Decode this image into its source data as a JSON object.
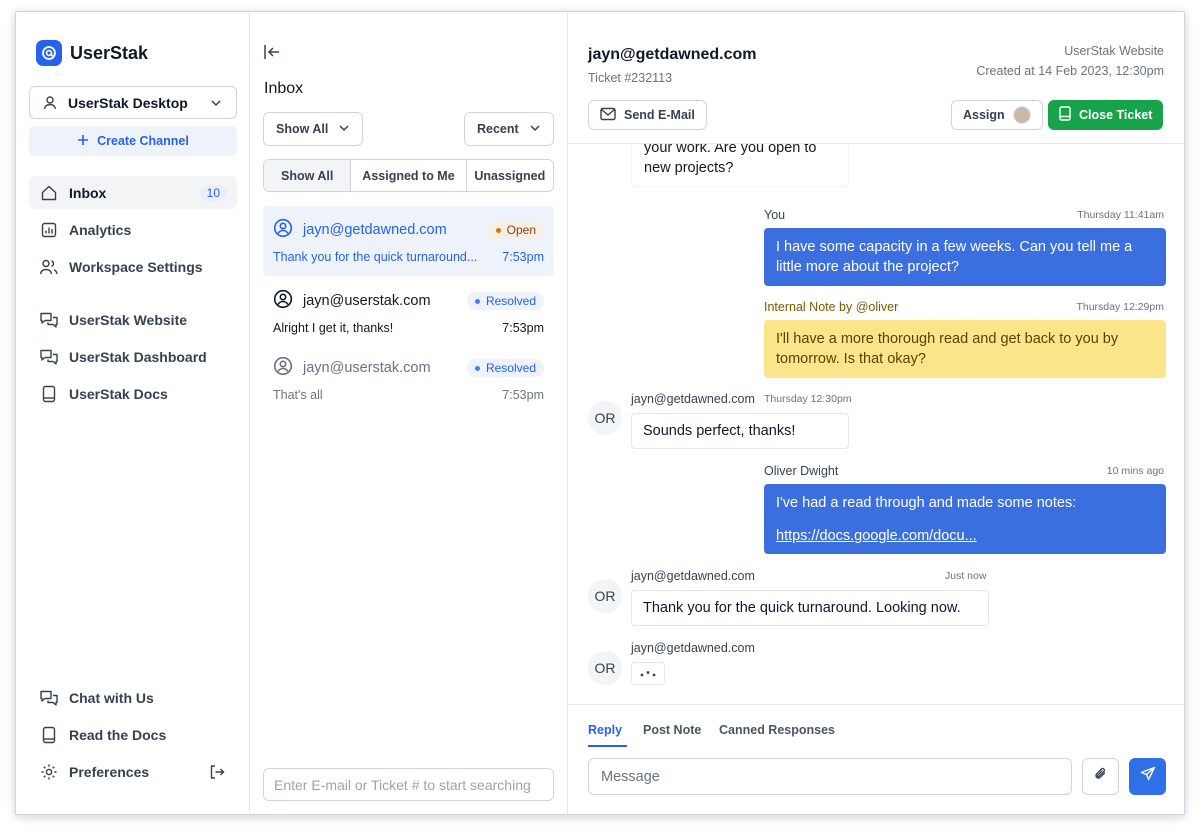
{
  "brand": {
    "name": "UserStak"
  },
  "sidebar": {
    "channel_select": "UserStak Desktop",
    "create_channel": "Create Channel",
    "nav": [
      {
        "label": "Inbox",
        "icon": "home-icon",
        "badge": "10"
      },
      {
        "label": "Analytics",
        "icon": "chart-icon"
      },
      {
        "label": "Workspace Settings",
        "icon": "users-icon"
      }
    ],
    "channels": [
      {
        "label": "UserStak Website",
        "icon": "chat-bubbles-icon"
      },
      {
        "label": "UserStak Dashboard",
        "icon": "chat-bubbles-icon"
      },
      {
        "label": "UserStak Docs",
        "icon": "book-icon"
      }
    ],
    "footer": [
      {
        "label": "Chat with Us",
        "icon": "chat-bubbles-icon"
      },
      {
        "label": "Read the Docs",
        "icon": "book-icon"
      },
      {
        "label": "Preferences",
        "icon": "gear-icon"
      }
    ]
  },
  "inbox": {
    "title": "Inbox",
    "filter": "Show All",
    "sort": "Recent",
    "segments": [
      "Show All",
      "Assigned to Me",
      "Unassigned"
    ],
    "conversations": [
      {
        "email": "jayn@getdawned.com",
        "status": "Open",
        "preview": "Thank you for the quick turnaround...",
        "time": "7:53pm"
      },
      {
        "email": "jayn@userstak.com",
        "status": "Resolved",
        "preview": "Alright I get it, thanks!",
        "time": "7:53pm"
      },
      {
        "email": "jayn@userstak.com",
        "status": "Resolved",
        "preview": "That's all",
        "time": "7:53pm"
      }
    ],
    "search_placeholder": "Enter E-mail or Ticket # to start searching"
  },
  "ticket": {
    "email": "jayn@getdawned.com",
    "number": "Ticket #232113",
    "site": "UserStak Website",
    "created": "Created at 14 Feb 2023, 12:30pm",
    "send_email": "Send E-Mail",
    "assign": "Assign",
    "close": "Close Ticket"
  },
  "messages": {
    "m0": {
      "text": "your work. Are you open to new projects?"
    },
    "m1": {
      "author": "You",
      "time": "Thursday 11:41am",
      "text": "I have some capacity in a few weeks. Can you tell me a little more about the project?"
    },
    "m2": {
      "author": "Internal Note by @oliver",
      "time": "Thursday 12:29pm",
      "text": "I'll have a more thorough read and get back to you by tomorrow. Is that okay?"
    },
    "m3": {
      "initials": "OR",
      "author": "jayn@getdawned.com",
      "time": "Thursday 12:30pm",
      "text": "Sounds perfect, thanks!"
    },
    "m4": {
      "author": "Oliver Dwight",
      "time": "10 mins ago",
      "text": "I've had a read through and made some notes:",
      "link": "https://docs.google.com/docu..."
    },
    "m5": {
      "initials": "OR",
      "author": "jayn@getdawned.com",
      "time": "Just now",
      "text": "Thank you for the quick turnaround. Looking now."
    },
    "m6": {
      "initials": "OR",
      "author": "jayn@getdawned.com"
    }
  },
  "composer": {
    "tabs": [
      "Reply",
      "Post Note",
      "Canned Responses"
    ],
    "placeholder": "Message"
  },
  "colors": {
    "accent": "#2563eb",
    "out_bubble": "#3b6fe0",
    "note": "#fbe58a",
    "close": "#16a34a",
    "open_status": "#b45309"
  }
}
